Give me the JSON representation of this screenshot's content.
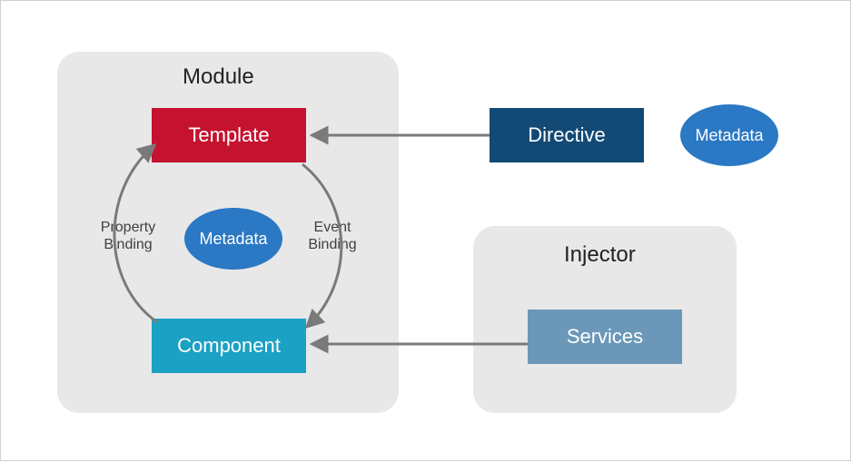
{
  "module": {
    "title": "Module",
    "template": "Template",
    "component": "Component",
    "metadata": "Metadata",
    "leftLabel": "Property\nBinding",
    "rightLabel": "Event\nBinding"
  },
  "directive": {
    "label": "Directive",
    "metadata": "Metadata"
  },
  "injector": {
    "title": "Injector",
    "services": "Services"
  },
  "colors": {
    "panel": "#e8e8e8",
    "template": "#c4122f",
    "component": "#1ba1c4",
    "metadata": "#2b78c4",
    "directive": "#134a75",
    "services": "#6b98b8",
    "arrow": "#7a7a7a"
  }
}
